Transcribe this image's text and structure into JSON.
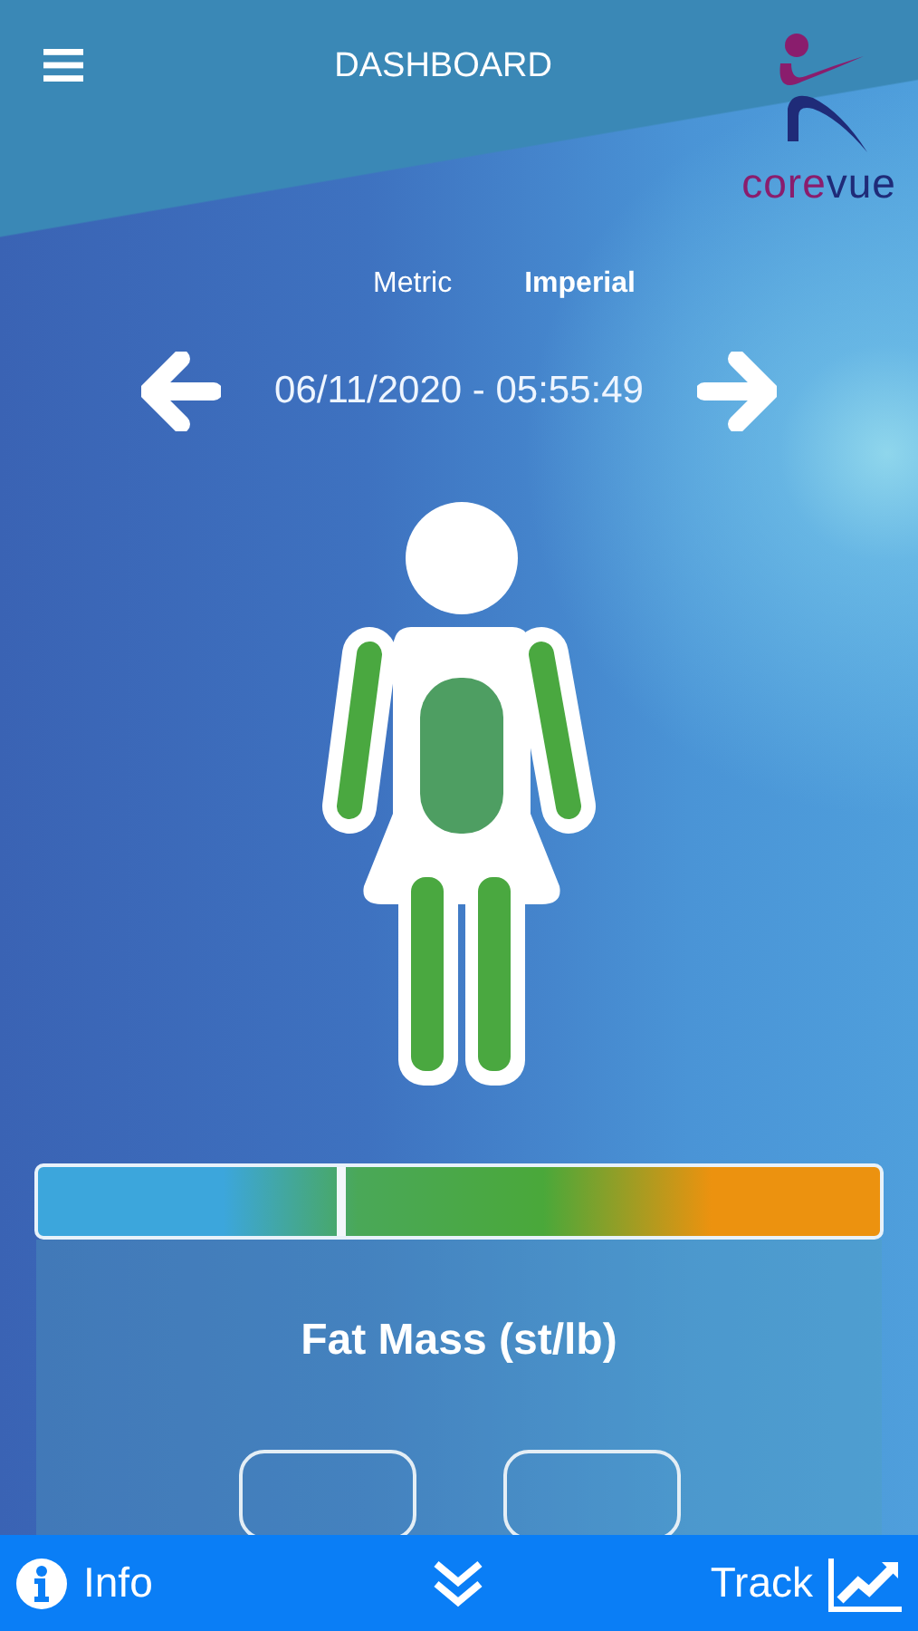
{
  "header": {
    "title": "DASHBOARD",
    "logo_parts": [
      "core",
      "vue"
    ]
  },
  "unit_tabs": [
    {
      "label": "Metric",
      "selected": false
    },
    {
      "label": "Imperial",
      "selected": true
    }
  ],
  "date_nav": {
    "timestamp": "06/11/2020 - 05:55:49"
  },
  "scale": {
    "level": 0.36
  },
  "metric_card": {
    "title": "Fat Mass (st/lb)"
  },
  "bottom_bar": {
    "info": "Info",
    "track": "Track"
  }
}
